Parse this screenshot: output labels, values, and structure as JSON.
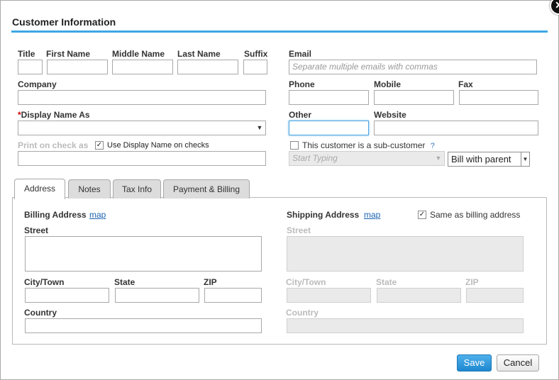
{
  "dialog": {
    "title": "Customer Information",
    "close_glyph": "✕"
  },
  "name": {
    "title_label": "Title",
    "first_label": "First Name",
    "middle_label": "Middle Name",
    "last_label": "Last Name",
    "suffix_label": "Suffix",
    "company_label": "Company",
    "display_required_mark": "*",
    "display_label": "Display Name As",
    "print_label": "Print on check as",
    "use_display_label": "Use Display Name on checks",
    "use_display_checked": "✓"
  },
  "contact": {
    "email_label": "Email",
    "email_placeholder": "Separate multiple emails with commas",
    "phone_label": "Phone",
    "mobile_label": "Mobile",
    "fax_label": "Fax",
    "other_label": "Other",
    "website_label": "Website",
    "subcustomer_label": "This customer is a sub-customer",
    "subcustomer_help": "?",
    "parent_placeholder": "Start Typing",
    "bill_option": "Bill with parent"
  },
  "tabs": [
    {
      "label": "Address"
    },
    {
      "label": "Notes"
    },
    {
      "label": "Tax Info"
    },
    {
      "label": "Payment & Billing"
    }
  ],
  "billing": {
    "heading": "Billing Address",
    "map_link": "map",
    "street_label": "Street",
    "city_label": "City/Town",
    "state_label": "State",
    "zip_label": "ZIP",
    "country_label": "Country"
  },
  "shipping": {
    "heading": "Shipping Address",
    "map_link": "map",
    "same_label": "Same as billing address",
    "same_checked": "✓",
    "street_label": "Street",
    "city_label": "City/Town",
    "state_label": "State",
    "zip_label": "ZIP",
    "country_label": "Country"
  },
  "footer": {
    "save_label": "Save",
    "cancel_label": "Cancel"
  },
  "glyphs": {
    "dropdown": "▼"
  },
  "colors": {
    "accent": "#3ea7e5",
    "save_button": "#2a94d8",
    "required": "#cc0000",
    "link": "#1a63b3"
  }
}
